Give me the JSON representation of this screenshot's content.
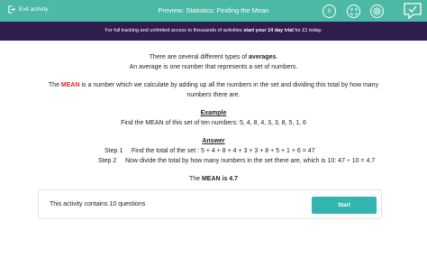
{
  "topbar": {
    "exit_label": "Exit activity",
    "title": "Preview: Statistics: Finding the Mean",
    "badge_count": "0",
    "accent_color": "#4bb9a3"
  },
  "banner": {
    "text_before": "For full tracking and unlimited access to thousands of activities ",
    "text_bold": "start your 14 day trial",
    "text_after": " for £1 today.",
    "background_color": "#2d1e4e"
  },
  "intro": {
    "line1_before": "There are several different types of ",
    "line1_bold": "averages",
    "line1_after": ".",
    "line2": "An average is one number that represents a set of numbers.",
    "mean_word": "MEAN",
    "definition_before": "The ",
    "definition_after": "  is a  number which we calculate by adding up all the numbers in the set and dividing this total by how many",
    "definition_line2": "numbers there are."
  },
  "example": {
    "heading": "Example",
    "question": "Find the MEAN of this set of ten numbers:    5,  4,  8,  4,  3,  3,  8,  5,  1,  6"
  },
  "answer": {
    "heading": "Answer",
    "step1_label": "Step 1",
    "step1_text": "Find the total of the set :   5 + 4 + 8 + 4 + 3 + 3 + 8 + 5 + 1 + 6 = 47",
    "step2_label": "Step 2",
    "step2_text": "Now divide the total by how many numbers in the set there are, which is 10:  47 ÷ 10 = 4.7",
    "result_before": "The ",
    "result_bold": "MEAN is 4.7"
  },
  "card": {
    "text": "This activity contains 10 questions",
    "start_label": "Start",
    "button_color": "#33b4ae"
  }
}
